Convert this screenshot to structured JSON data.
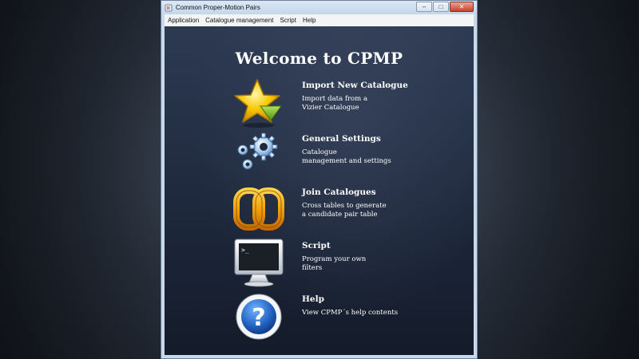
{
  "window": {
    "title": "Common Proper-Motion Pairs",
    "controls": {
      "minimize": "–",
      "maximize": "□",
      "close": "✕"
    }
  },
  "menu": [
    "Application",
    "Catalogue management",
    "Script",
    "Help"
  ],
  "welcome": "Welcome to CPMP",
  "items": [
    {
      "heading": "Import New Catalogue",
      "desc": [
        "Import data from a",
        "Vizier Catalogue"
      ],
      "icon": "star-import-icon"
    },
    {
      "heading": "General Settings",
      "desc": [
        "Catalogue",
        "management and settings"
      ],
      "icon": "gears-icon"
    },
    {
      "heading": "Join Catalogues",
      "desc": [
        "Cross tables to generate",
        "a candidate pair table"
      ],
      "icon": "join-rings-icon"
    },
    {
      "heading": "Script",
      "desc": [
        "Program your own",
        "filters"
      ],
      "icon": "terminal-icon"
    },
    {
      "heading": "Help",
      "desc": [
        "View CPMP´s help contents"
      ],
      "icon": "help-icon"
    }
  ],
  "colors": {
    "star": "#f7c600",
    "arrow": "#7ab82a",
    "gear": "#8fb8e6",
    "rings": "#f2a20a",
    "help": "#1f5fbf"
  }
}
